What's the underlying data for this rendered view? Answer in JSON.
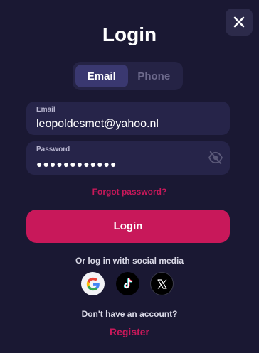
{
  "header": {
    "title": "Login",
    "close_icon": "close-icon"
  },
  "tabs": [
    {
      "label": "Email",
      "active": true
    },
    {
      "label": "Phone",
      "active": false
    }
  ],
  "email_field": {
    "label": "Email",
    "value": "leopoldesmet@yahoo.nl"
  },
  "password_field": {
    "label": "Password",
    "value": "●●●●●●●●●●●●",
    "toggle_icon": "eye-off-icon"
  },
  "forgot_password": "Forgot password?",
  "login_button": "Login",
  "social": {
    "label": "Or log in with social media",
    "providers": [
      {
        "name": "Google",
        "icon": "google-icon"
      },
      {
        "name": "TikTok",
        "icon": "tiktok-icon"
      },
      {
        "name": "X",
        "icon": "x-icon"
      }
    ]
  },
  "footer": {
    "no_account": "Don't have an account?",
    "register": "Register"
  },
  "colors": {
    "background": "#1a1833",
    "accent": "#c8185a",
    "field_bg": "#262449",
    "tab_active": "#3a3870"
  }
}
